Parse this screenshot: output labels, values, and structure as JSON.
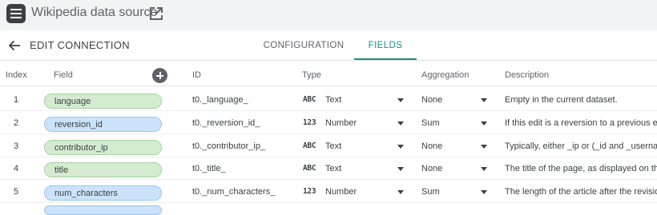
{
  "app": {
    "title": "Wikipedia data source",
    "partial_top_text": "' ' ' '"
  },
  "header": {
    "title": "EDIT CONNECTION",
    "tabs": [
      {
        "label": "CONFIGURATION",
        "active": false
      },
      {
        "label": "FIELDS",
        "active": true
      }
    ]
  },
  "columns": {
    "index": "Index",
    "field": "Field",
    "id": "ID",
    "type": "Type",
    "aggregation": "Aggregation",
    "description": "Description"
  },
  "rows": [
    {
      "index": "1",
      "field": "language",
      "kind": "dimension",
      "id": "t0._language_",
      "type_icon": "ABC",
      "type": "Text",
      "aggregation": "None",
      "description": "Empty in the current dataset."
    },
    {
      "index": "2",
      "field": "reversion_id",
      "kind": "metric",
      "id": "t0._reversion_id_",
      "type_icon": "123",
      "type": "Number",
      "aggregation": "Sum",
      "description": "If this edit is a reversion to a previous ed"
    },
    {
      "index": "3",
      "field": "contributor_ip",
      "kind": "dimension",
      "id": "t0._contributor_ip_",
      "type_icon": "ABC",
      "type": "Text",
      "aggregation": "None",
      "description": "Typically, either _ip or (_id and _usernam"
    },
    {
      "index": "4",
      "field": "title",
      "kind": "dimension",
      "id": "t0._title_",
      "type_icon": "ABC",
      "type": "Text",
      "aggregation": "None",
      "description": "The title of the page, as displayed on the"
    },
    {
      "index": "5",
      "field": "num_characters",
      "kind": "metric",
      "id": "t0._num_characters_",
      "type_icon": "123",
      "type": "Number",
      "aggregation": "Sum",
      "description": "The length of the article after the revisio"
    }
  ],
  "colors": {
    "accent": "#1a8f80",
    "dimension_pill": "#d4ebd1",
    "metric_pill": "#cbe2f8"
  }
}
